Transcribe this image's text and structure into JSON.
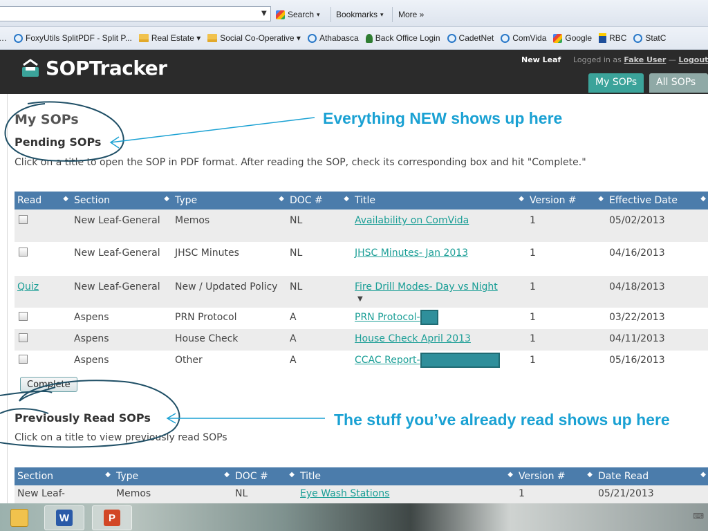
{
  "browser": {
    "search_label": "Search",
    "bookmarks_label": "Bookmarks",
    "more_label": "More »",
    "bookmarks_bar": [
      "FoxyUtils SplitPDF - Split P...",
      "Real Estate ▾",
      "Social Co-Operative ▾",
      "Athabasca",
      "Back Office Login",
      "CadetNet",
      "ComVida",
      "Google",
      "RBC",
      "StatC"
    ]
  },
  "header": {
    "logo_text": "SOPTracker",
    "org_name": "New Leaf",
    "logged_in_prefix": "Logged in as",
    "user_name": "Fake User",
    "separator": " — ",
    "logout_label": "Logout",
    "tabs": [
      "My SOPs",
      "All SOPs"
    ]
  },
  "page": {
    "title": "My SOPs",
    "pending": {
      "title": "Pending SOPs",
      "help": "Click on a title to open the SOP in PDF format. After reading the SOP, check its corresponding box and hit \"Complete.\"",
      "columns": [
        "Read",
        "Section",
        "Type",
        "DOC #",
        "Title",
        "Version #",
        "Effective Date"
      ],
      "rows": [
        {
          "read": "checkbox",
          "section": "New Leaf-General",
          "type": "Memos",
          "doc": "NL",
          "title": "Availability on ComVida",
          "version": "1",
          "date": "05/02/2013"
        },
        {
          "read": "checkbox",
          "section": "New Leaf-General",
          "type": "JHSC Minutes",
          "doc": "NL",
          "title": "JHSC Minutes- Jan 2013",
          "version": "1",
          "date": "04/16/2013"
        },
        {
          "read": "Quiz",
          "section": "New Leaf-General",
          "type": "New / Updated Policy",
          "doc": "NL",
          "title": "Fire Drill Modes- Day vs Night",
          "version": "1",
          "date": "04/18/2013"
        },
        {
          "read": "checkbox",
          "section": "Aspens",
          "type": "PRN Protocol",
          "doc": "A",
          "title": "PRN Protocol-",
          "version": "1",
          "date": "03/22/2013"
        },
        {
          "read": "checkbox",
          "section": "Aspens",
          "type": "House Check",
          "doc": "A",
          "title": "House Check April 2013",
          "version": "1",
          "date": "04/11/2013"
        },
        {
          "read": "checkbox",
          "section": "Aspens",
          "type": "Other",
          "doc": "A",
          "title": "CCAC Report-",
          "version": "1",
          "date": "05/16/2013"
        }
      ],
      "complete_label": "Complete"
    },
    "previous": {
      "title": "Previously Read SOPs",
      "help": "Click on a title to view previously read SOPs",
      "columns": [
        "Section",
        "Type",
        "DOC #",
        "Title",
        "Version #",
        "Date Read"
      ],
      "rows": [
        {
          "section": "New Leaf-",
          "type": "Memos",
          "doc": "NL",
          "title": "Eye Wash Stations",
          "version": "1",
          "date": "05/21/2013"
        }
      ]
    }
  },
  "annotations": {
    "new_note": "Everything NEW shows up here",
    "read_note": "The stuff you’ve already read shows up here",
    "color": "#1aa1d3"
  },
  "colors": {
    "table_header": "#4b7cab",
    "link": "#1a9e96",
    "tab_active": "#3ba39a",
    "header_bg": "#2b2b2b"
  }
}
